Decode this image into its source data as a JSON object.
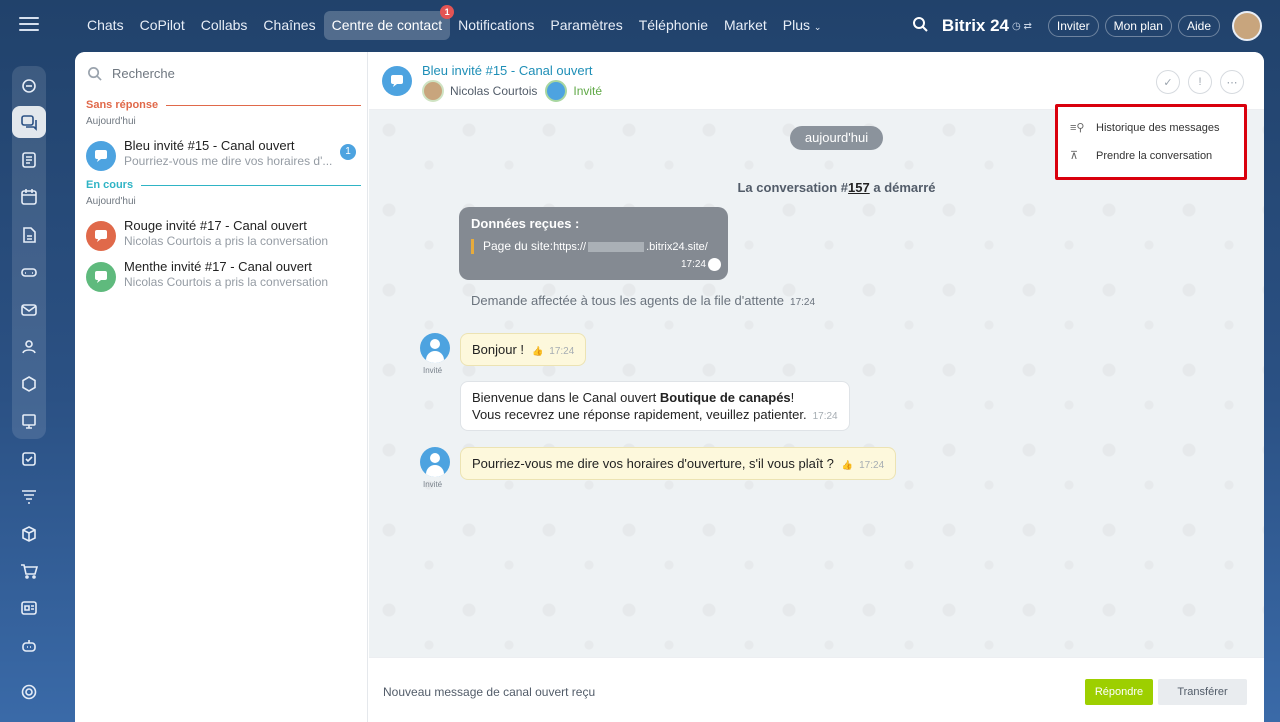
{
  "topnav": {
    "tabs": [
      "Chats",
      "CoPilot",
      "Collabs",
      "Chaînes",
      "Centre de contact",
      "Notifications",
      "Paramètres",
      "Téléphonie",
      "Market",
      "Plus"
    ],
    "active_index": 4,
    "badge": "1",
    "brand": "Bitrix 24",
    "brand_extra": "◷ ⇄",
    "buttons": [
      "Inviter",
      "Mon plan",
      "Aide"
    ]
  },
  "recents": {
    "search_placeholder": "Recherche",
    "sections": [
      {
        "title": "Sans réponse",
        "subtitle": "Aujourd'hui",
        "color": "#e0694a"
      },
      {
        "title": "En cours",
        "subtitle": "Aujourd'hui",
        "color": "#2fb4c5"
      }
    ],
    "items": [
      {
        "title": "Bleu invité #15 - Canal ouvert",
        "subtitle": "Pourriez-vous me dire vos horaires d'...",
        "color": "#4da3e0",
        "counter": "1"
      },
      {
        "title": "Rouge invité #17 - Canal ouvert",
        "subtitle": "Nicolas Courtois a pris la conversation",
        "color": "#e0694a"
      },
      {
        "title": "Menthe invité #17 - Canal ouvert",
        "subtitle": "Nicolas Courtois a pris la conversation",
        "color": "#5fba7d"
      }
    ]
  },
  "chat": {
    "title": "Bleu invité #15 - Canal ouvert",
    "user": "Nicolas Courtois",
    "guest": "Invité",
    "date_pill": "aujourd'hui",
    "conv_prefix": "La conversation #",
    "conv_number": "157",
    "conv_suffix": " a démarré",
    "system": {
      "title": "Données reçues :",
      "page_label": "Page du site:",
      "url_start": "https://",
      "url_end": ".bitrix24.site/",
      "time": "17:24"
    },
    "notice": "Demande affectée à tous les agents de la file d'attente",
    "notice_time": "17:24",
    "guest_label": "Invité",
    "msg1": "Bonjour !",
    "msg1_time": "17:24",
    "welcome_prefix": "Bienvenue dans le Canal ouvert ",
    "welcome_bold": "Boutique de canapés",
    "welcome_suffix": "!",
    "welcome_line2": "Vous recevrez une réponse rapidement, veuillez patienter.",
    "welcome_time": "17:24",
    "msg2": "Pourriez-vous me dire vos horaires d'ouverture, s'il vous plaît ?",
    "msg2_time": "17:24",
    "footer_text": "Nouveau message de canal ouvert reçu",
    "reply_label": "Répondre",
    "transfer_label": "Transférer"
  },
  "menu": {
    "items": [
      {
        "label": "Historique des messages",
        "icon": "history-icon"
      },
      {
        "label": "Prendre la conversation",
        "icon": "take-icon"
      }
    ],
    "highlight_color": "#d9000d"
  }
}
